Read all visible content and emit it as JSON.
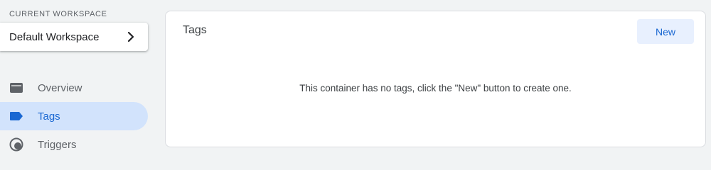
{
  "sidebar": {
    "workspace_label": "CURRENT WORKSPACE",
    "workspace_name": "Default Workspace",
    "nav": [
      {
        "label": "Overview",
        "icon": "folder-icon",
        "active": false
      },
      {
        "label": "Tags",
        "icon": "label-icon",
        "active": true
      },
      {
        "label": "Triggers",
        "icon": "trigger-icon",
        "active": false
      }
    ]
  },
  "main": {
    "title": "Tags",
    "new_button_label": "New",
    "empty_message": "This container has no tags, click the \"New\" button to create one."
  },
  "colors": {
    "accent": "#1967d2",
    "active_nav_bg": "#d2e3fc",
    "new_button_bg": "#e8f0fe",
    "page_bg": "#f1f3f4",
    "icon_gray": "#5f6368"
  }
}
